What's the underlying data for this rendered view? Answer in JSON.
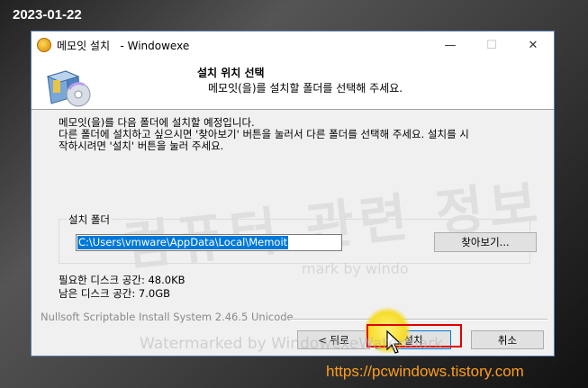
{
  "overlay": {
    "date": "2023-01-22",
    "site_url": "https://pcwindows.tistory.com"
  },
  "window": {
    "title": "메모잇 설치   - Windowexe",
    "controls": {
      "minimize": "—",
      "maximize": "☐",
      "close": "✕"
    },
    "header": {
      "title": "설치 위치 선택",
      "subtitle": "메모잇(을)를 설치할 폴더를 선택해 주세요."
    },
    "intro_lines": [
      "메모잇(을)를 다음 폴더에 설치할 예정입니다.",
      "다른 폴더에 설치하고 싶으시면 '찾아보기' 버튼을 눌러서 다른 폴더를 선택해 주세요. 설치를 시",
      "작하시려면 '설치' 버튼을 눌러 주세요."
    ],
    "folder_group": {
      "label": "설치 폴더",
      "path": "C:\\Users\\vmware\\AppData\\Local\\Memoit",
      "browse_label": "찾아보기..."
    },
    "space": {
      "required": "필요한 디스크 공간: 48.0KB",
      "available": "남은 디스크 공간: 7.0GB"
    },
    "branding": "Nullsoft Scriptable Install System 2.46.5 Unicode",
    "buttons": {
      "back": "< 뒤로",
      "install": "설치",
      "cancel": "취소"
    }
  },
  "watermarks": {
    "big": "컴퓨터 관련 정보",
    "small": "Watermarked by WindowexeWatermark",
    "mid": "mark by windo"
  }
}
